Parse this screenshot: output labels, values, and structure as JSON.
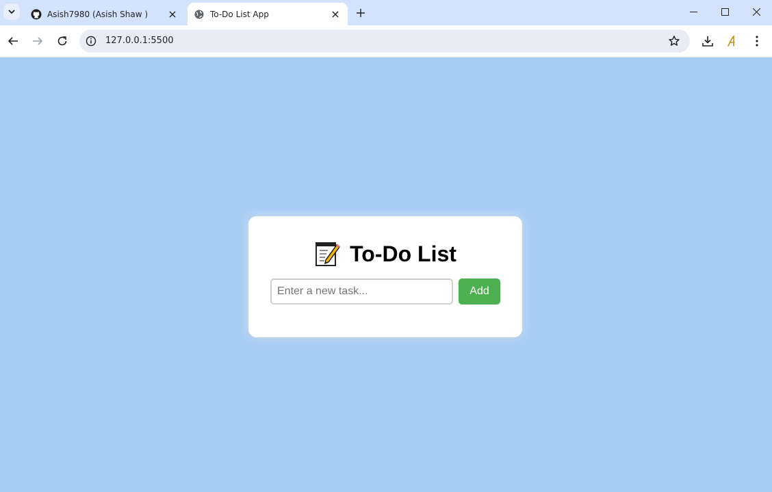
{
  "browser": {
    "tabs": [
      {
        "title": "Asish7980 (Asish Shaw )",
        "favicon": "github-icon",
        "active": false
      },
      {
        "title": "To-Do List App",
        "favicon": "globe-icon",
        "active": true
      }
    ],
    "url": "127.0.0.1:5500"
  },
  "app": {
    "heading": "To-Do List",
    "heading_icon": "memo-icon",
    "input_placeholder": "Enter a new task...",
    "add_label": "Add"
  },
  "colors": {
    "page_background": "#a8cdf3",
    "add_button": "#4caf50",
    "tabstrip": "#d3e3fd"
  }
}
